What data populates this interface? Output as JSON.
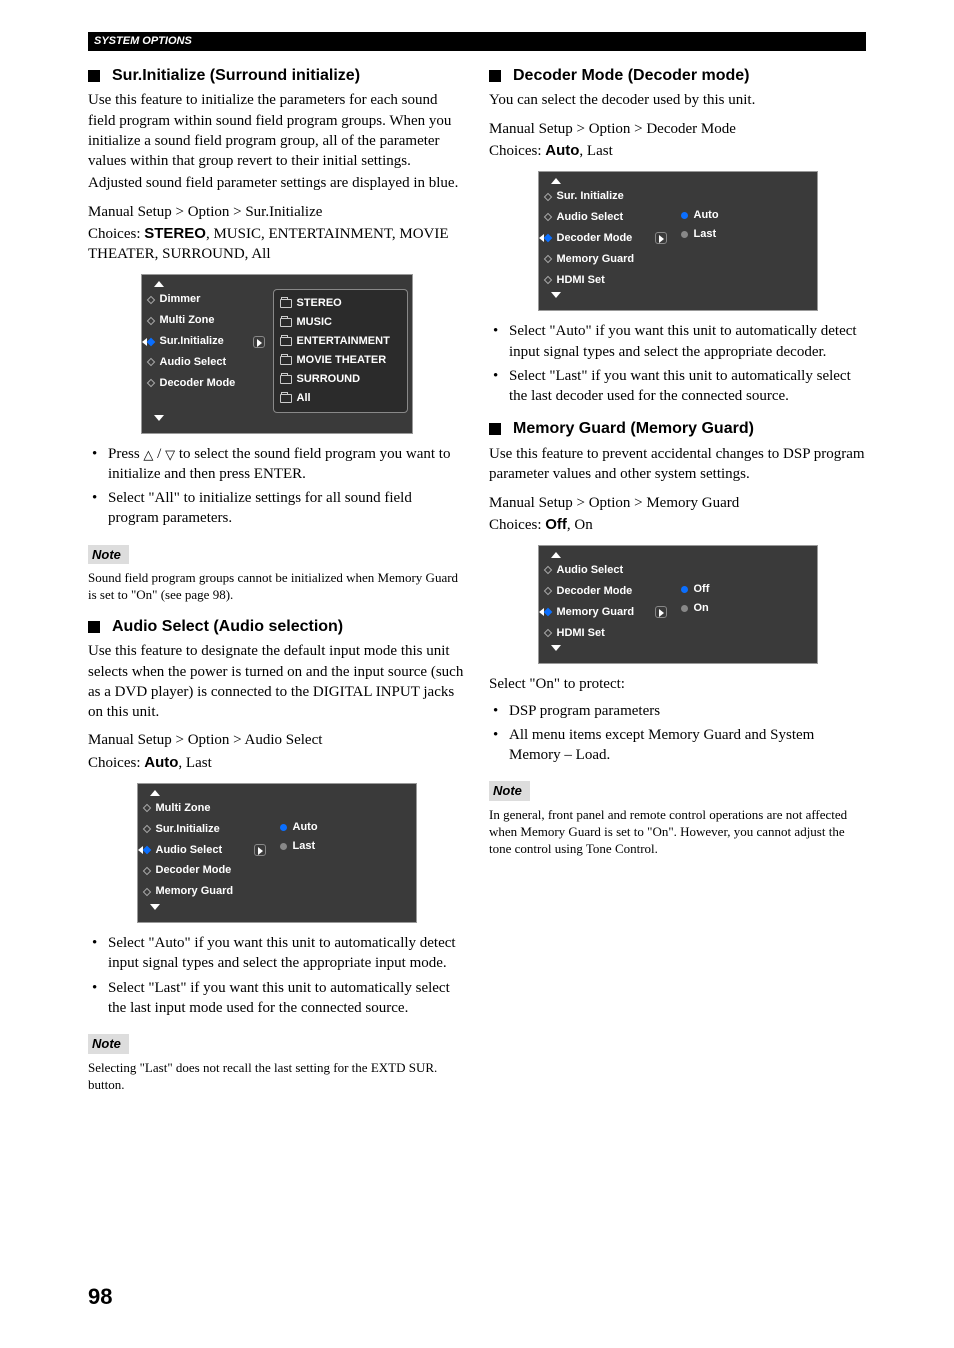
{
  "header": {
    "section": "SYSTEM OPTIONS"
  },
  "pageNumber": "98",
  "left": {
    "surInit": {
      "title": "Sur.Initialize (Surround initialize)",
      "desc1": "Use this feature to initialize the parameters for each sound field program within sound field program groups. When you initialize a sound field program group, all of the parameter values within that group revert to their initial settings.",
      "desc2": "Adjusted sound field parameter settings are displayed in blue.",
      "path": "Manual Setup > Option > Sur.Initialize",
      "choicesLabel": "Choices: ",
      "choicesBold": "STEREO",
      "choicesRest": ", MUSIC, ENTERTAINMENT, MOVIE THEATER, SURROUND, All",
      "osd": {
        "left": [
          "Dimmer",
          "Multi Zone",
          "Sur.Initialize",
          "Audio Select",
          "Decoder Mode"
        ],
        "selectedIndex": 2,
        "right": [
          "STEREO",
          "MUSIC",
          "ENTERTAINMENT",
          "MOVIE THEATER",
          "SURROUND",
          "All"
        ]
      },
      "b1a": "Press ",
      "b1b": " to select the sound field program you want to initialize and then press ENTER.",
      "b2": "Select \"All\" to initialize settings for all sound field program parameters.",
      "noteBadge": "Note",
      "noteText": "Sound field program groups cannot be initialized when Memory Guard is set to \"On\" (see page 98)."
    },
    "audioSelect": {
      "title": "Audio Select (Audio selection)",
      "desc": "Use this feature to designate the default input mode this unit selects when the power is turned on and the input source (such as a DVD player) is connected to the DIGITAL INPUT jacks on this unit.",
      "path": "Manual Setup > Option > Audio Select",
      "choicesLabel": "Choices: ",
      "choicesBold": "Auto",
      "choicesRest": ", Last",
      "osd": {
        "left": [
          "Multi Zone",
          "Sur.Initialize",
          "Audio Select",
          "Decoder Mode",
          "Memory Guard"
        ],
        "selectedIndex": 2,
        "right": [
          "Auto",
          "Last"
        ],
        "rightSelected": 0
      },
      "b1": "Select \"Auto\" if you want this unit to automatically detect input signal types and select the appropriate input mode.",
      "b2": "Select \"Last\" if you want this unit to automatically select the last input mode used for the connected source.",
      "noteBadge": "Note",
      "noteText": "Selecting \"Last\" does not recall the last setting for the EXTD SUR. button."
    }
  },
  "right": {
    "decoder": {
      "title": "Decoder Mode (Decoder mode)",
      "desc": "You can select the decoder used by this unit.",
      "path": "Manual Setup > Option > Decoder Mode",
      "choicesLabel": "Choices: ",
      "choicesBold": "Auto",
      "choicesRest": ", Last",
      "osd": {
        "left": [
          "Sur. Initialize",
          "Audio Select",
          "Decoder Mode",
          "Memory Guard",
          "HDMI Set"
        ],
        "selectedIndex": 2,
        "right": [
          "Auto",
          "Last"
        ],
        "rightSelected": 0
      },
      "b1": "Select \"Auto\" if you want this unit to automatically detect input signal types and select the appropriate decoder.",
      "b2": "Select \"Last\" if you want this unit to automatically select the last decoder used for the connected source."
    },
    "memGuard": {
      "title": "Memory Guard (Memory Guard)",
      "desc": "Use this feature to prevent accidental changes to DSP program parameter values and other system settings.",
      "path": "Manual Setup > Option > Memory Guard",
      "choicesLabel": "Choices: ",
      "choicesBold": "Off",
      "choicesRest": ", On",
      "osd": {
        "left": [
          "Audio Select",
          "Decoder Mode",
          "Memory Guard",
          "HDMI Set"
        ],
        "selectedIndex": 2,
        "right": [
          "Off",
          "On"
        ],
        "rightSelected": 0
      },
      "protectLead": "Select \"On\" to protect:",
      "p1": "DSP program parameters",
      "p2": "All menu items except Memory Guard and System Memory – Load.",
      "noteBadge": "Note",
      "noteText": "In general, front panel and remote control operations are not affected when Memory Guard is set to \"On\". However, you cannot adjust the tone control using Tone Control."
    }
  }
}
